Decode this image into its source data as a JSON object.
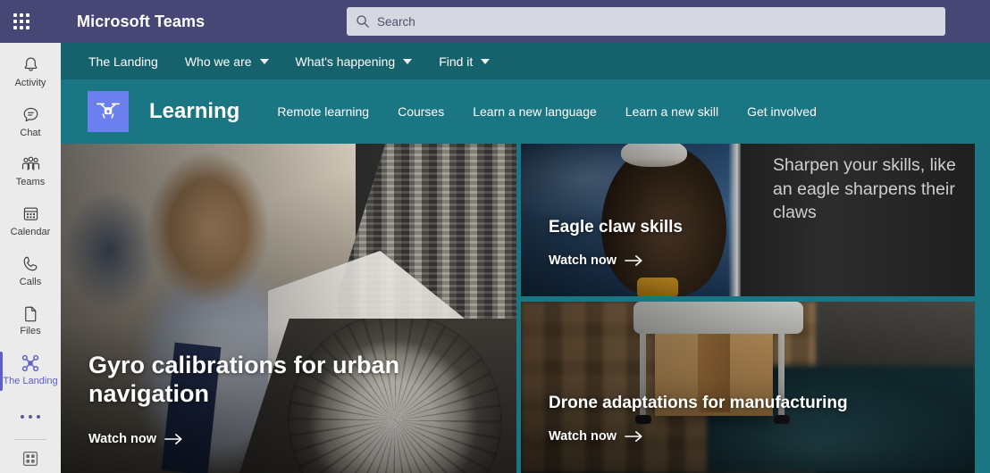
{
  "topbar": {
    "app_title": "Microsoft Teams",
    "waffle_icon": "app-launcher-waffle-icon",
    "brand_color": "#464775",
    "search": {
      "placeholder": "Search",
      "value": "",
      "icon": "search-icon",
      "background": "#d6d7e1"
    }
  },
  "rail": {
    "items": [
      {
        "label": "Activity",
        "icon": "bell-icon",
        "active": false
      },
      {
        "label": "Chat",
        "icon": "chat-bubble-icon",
        "active": false
      },
      {
        "label": "Teams",
        "icon": "people-icon",
        "active": false
      },
      {
        "label": "Calendar",
        "icon": "calendar-icon",
        "active": false
      },
      {
        "label": "Calls",
        "icon": "phone-icon",
        "active": false
      },
      {
        "label": "Files",
        "icon": "file-icon",
        "active": false
      },
      {
        "label": "The Landing",
        "icon": "drone-icon",
        "active": true
      }
    ],
    "more_icon": "more-ellipsis-icon",
    "apps_icon": "apps-grid-icon",
    "active_color": "#5b5fc7",
    "background": "#ebebeb"
  },
  "sitenav": {
    "background": "#15626c",
    "items": [
      {
        "label": "The Landing",
        "has_caret": false
      },
      {
        "label": "Who we are",
        "has_caret": true
      },
      {
        "label": "What's happening",
        "has_caret": true
      },
      {
        "label": "Find it",
        "has_caret": true
      }
    ]
  },
  "hub": {
    "background": "#1a7683",
    "logo_icon": "drone-logo-icon",
    "logo_color": "#6b7fee",
    "title": "Learning",
    "links": [
      {
        "label": "Remote learning"
      },
      {
        "label": "Courses"
      },
      {
        "label": "Learn a new language"
      },
      {
        "label": "Learn a new skill"
      },
      {
        "label": "Get involved"
      }
    ]
  },
  "cards": {
    "featured": {
      "title": "Gyro calibrations for urban navigation",
      "cta": "Watch now",
      "cta_icon": "arrow-right-icon",
      "image_alt": "student-cityscape-compass-collage"
    },
    "eagle": {
      "title": "Eagle claw skills",
      "cta": "Watch now",
      "cta_icon": "arrow-right-icon",
      "quote": "Sharpen your skills, like an eagle sharpens their claws",
      "image_alt": "bald-eagle-photo"
    },
    "drone": {
      "title": "Drone adaptations for manufacturing",
      "cta": "Watch now",
      "cta_icon": "arrow-right-icon",
      "image_alt": "delivery-drone-carrying-box"
    }
  }
}
